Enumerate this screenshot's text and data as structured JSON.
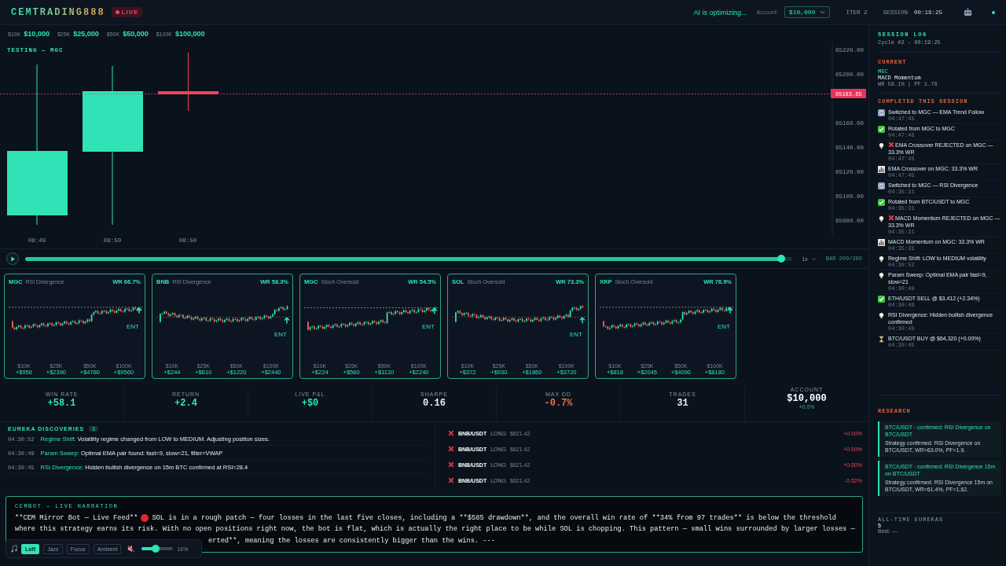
{
  "header": {
    "logo": "CEMTRADING888",
    "live_badge": "LIVE",
    "status": "AI is optimizing...",
    "account_label": "Account:",
    "account_value": "$10,000",
    "iter": "ITER 2",
    "session_label": "SESSION",
    "session_time": "00:19:25"
  },
  "capital_presets": [
    {
      "label": "$10K",
      "value": "$10,000"
    },
    {
      "label": "$25K",
      "value": "$25,000"
    },
    {
      "label": "$50K",
      "value": "$50,000"
    },
    {
      "label": "$100K",
      "value": "$100,000"
    }
  ],
  "chart": {
    "title": "TESTING — MGC",
    "y_ticks": [
      "65220.00",
      "65200.00",
      "65160.00",
      "65140.00",
      "65120.00",
      "65100.00",
      "65080.00"
    ],
    "price_tag": "65183.65",
    "x_labels": [
      "08:49",
      "08:50",
      "08:50"
    ]
  },
  "playback": {
    "level": 0.985,
    "speed": "1x",
    "bar": "BAR 200/200"
  },
  "strategy_cards": [
    {
      "symbol": "MGC",
      "strategy": "RSI Divergence",
      "win_rate": "WR 66.7%",
      "marker": "ENT",
      "tiers": [
        {
          "label": "$10K",
          "value": "+$956"
        },
        {
          "label": "$25K",
          "value": "+$2390"
        },
        {
          "label": "$50K",
          "value": "+$4780"
        },
        {
          "label": "$100K",
          "value": "+$9560"
        }
      ]
    },
    {
      "symbol": "BNB",
      "strategy": "RSI Divergence",
      "win_rate": "WR 58.3%",
      "marker": "ENT",
      "tiers": [
        {
          "label": "$10K",
          "value": "+$244"
        },
        {
          "label": "$25K",
          "value": "+$610"
        },
        {
          "label": "$50K",
          "value": "+$1220"
        },
        {
          "label": "$100K",
          "value": "+$2440"
        }
      ]
    },
    {
      "symbol": "MGC",
      "strategy": "Stoch Oversold",
      "win_rate": "WR 54.5%",
      "marker": "ENT",
      "tiers": [
        {
          "label": "$10K",
          "value": "+$224"
        },
        {
          "label": "$25K",
          "value": "+$560"
        },
        {
          "label": "$50K",
          "value": "+$1120"
        },
        {
          "label": "$100K",
          "value": "+$2240"
        }
      ]
    },
    {
      "symbol": "SOL",
      "strategy": "Stoch Oversold",
      "win_rate": "WR 73.3%",
      "marker": "ENT",
      "tiers": [
        {
          "label": "$10K",
          "value": "+$372"
        },
        {
          "label": "$25K",
          "value": "+$930"
        },
        {
          "label": "$50K",
          "value": "+$1860"
        },
        {
          "label": "$100K",
          "value": "+$3720"
        }
      ]
    },
    {
      "symbol": "XRP",
      "strategy": "Stoch Oversold",
      "win_rate": "WR 76.9%",
      "marker": "ENT",
      "tiers": [
        {
          "label": "$10K",
          "value": "+$818"
        },
        {
          "label": "$25K",
          "value": "+$2045"
        },
        {
          "label": "$50K",
          "value": "+$4090"
        },
        {
          "label": "$100K",
          "value": "+$8180"
        }
      ]
    }
  ],
  "stats": [
    {
      "label": "WIN RATE",
      "value": "+58.1",
      "color": "#2fe3b6"
    },
    {
      "label": "RETURN",
      "value": "+2.4",
      "color": "#2fe3b6"
    },
    {
      "label": "LIVE P&L",
      "value": "+$0",
      "color": "#2fe3b6"
    },
    {
      "label": "SHARPE",
      "value": "0.16",
      "color": "#e6ecf2"
    },
    {
      "label": "MAX DD",
      "value": "-0.7%",
      "color": "#f06a4a"
    },
    {
      "label": "TRADES",
      "value": "31",
      "color": "#e6ecf2"
    }
  ],
  "account": {
    "label": "ACCOUNT",
    "value": "$10,000",
    "change": "+0.0%"
  },
  "discoveries": {
    "title": "EUREKA DISCOVERIES",
    "count": "3",
    "items": [
      {
        "time": "04:30:52",
        "label": "Regime Shift:",
        "text": "Volatility regime changed from LOW to MEDIUM. Adjusting position sizes."
      },
      {
        "time": "04:30:49",
        "label": "Param Sweep:",
        "text": "Optimal EMA pair found: fast=9, slow=21, filter=VWAP"
      },
      {
        "time": "04:30:45",
        "label": "RSI Divergence:",
        "text": "Hidden bullish divergence on 15m BTC confirmed at RSI=28.4"
      }
    ]
  },
  "trades": [
    {
      "pair": "BNB/USDT",
      "side": "LONG",
      "price": "$621.42",
      "pnl": "+0.00%"
    },
    {
      "pair": "BNB/USDT",
      "side": "LONG",
      "price": "$621.42",
      "pnl": "+0.00%"
    },
    {
      "pair": "BNB/USDT",
      "side": "LONG",
      "price": "$621.42",
      "pnl": "+0.00%"
    },
    {
      "pair": "BNB/USDT",
      "side": "LONG",
      "price": "$621.42",
      "pnl": "-0.52%"
    }
  ],
  "narration": {
    "title": "CEMBOT — LIVE NARRATION",
    "lead": "**CEM Mirror Bot — Live Feed**",
    "lines": [
      "SOL is in a rough patch — four losses in the last five closes, including a **$585 drawdown**, and the overall win rate of **34% from 97 trades** is below the threshold",
      "where this strategy earns its risk. With no open positions right now, the bot is flat, which is actually the right place to be while SOL is chopping. This pattern — small wins surrounded by larger losses —",
      "erted**, meaning the losses are consistently bigger than the wins. ---"
    ]
  },
  "player": {
    "tracks": [
      {
        "label": "Loft",
        "selected": true
      },
      {
        "label": "Jazz",
        "selected": false
      },
      {
        "label": "Focus",
        "selected": false
      },
      {
        "label": "Ambient",
        "selected": false
      }
    ],
    "muted": true,
    "volume": {
      "level": 0.45,
      "reading": "16%"
    }
  },
  "session_log": {
    "title": "SESSION LOG",
    "cycle": "Cycle #2 - 00:19:25",
    "current": {
      "label": "CURRENT",
      "symbol": "MGC",
      "strategy": "MACD Momentum",
      "stats": "WR 58.1% | PF 1.78"
    },
    "completed_label": "COMPLETED THIS SESSION",
    "items": [
      {
        "kind": "switch",
        "rejected": false,
        "text": "Switched to MGC — EMA Trend Follow",
        "time": "04:47:45"
      },
      {
        "kind": "check",
        "rejected": false,
        "text": "Rotated from MGC to MGC",
        "time": "04:47:46"
      },
      {
        "kind": "idea",
        "rejected": true,
        "text": "EMA Crossover REJECTED on MGC — 33.3% WR",
        "time": "04:47:45"
      },
      {
        "kind": "stats",
        "rejected": false,
        "text": "EMA Crossover on MGC: 33.3% WR",
        "time": "04:47:45"
      },
      {
        "kind": "switch",
        "rejected": false,
        "text": "Switched to MGC — RSI Divergence",
        "time": "04:35:31"
      },
      {
        "kind": "check",
        "rejected": false,
        "text": "Rotated from BTC/USDT to MGC",
        "time": "04:35:31"
      },
      {
        "kind": "idea",
        "rejected": true,
        "text": "MACD Momentum REJECTED on MGC — 33.3% WR",
        "time": "04:35:31"
      },
      {
        "kind": "stats",
        "rejected": false,
        "text": "MACD Momentum on MGC: 33.3% WR",
        "time": "04:35:31"
      },
      {
        "kind": "idea",
        "rejected": false,
        "text": "Regime Shift: LOW to MEDIUM volatility",
        "time": "04:30:52"
      },
      {
        "kind": "idea",
        "rejected": false,
        "text": "Param Sweep: Optimal EMA pair fast=9, slow=21",
        "time": "04:30:49"
      },
      {
        "kind": "check",
        "rejected": false,
        "text": "ETH/USDT SELL @ $3,412 (+2.34%)",
        "time": "04:30:49"
      },
      {
        "kind": "idea",
        "rejected": false,
        "text": "RSI Divergence: Hidden bullish divergence confirmed",
        "time": "04:30:45"
      },
      {
        "kind": "pending",
        "rejected": false,
        "text": "BTC/USDT BUY @ $64,320 (+0.00%)",
        "time": "04:30:45"
      }
    ]
  },
  "research": {
    "title": "RESEARCH",
    "items": [
      {
        "title": "BTC/USDT · confirmed: RSI Divergence on BTC/USDT",
        "text": "Strategy confirmed: RSI Divergence on BTC/USDT, WR=63.0%, PF=1.9."
      },
      {
        "title": "BTC/USDT · confirmed: RSI Divergence 15m on BTC/USDT",
        "text": "Strategy confirmed: RSI Divergence 15m on BTC/USDT, WR=61.4%, PF=1.62."
      }
    ]
  },
  "all_time": {
    "label": "ALL-TIME EUREKAS",
    "count": "5",
    "best": "Best: —"
  }
}
